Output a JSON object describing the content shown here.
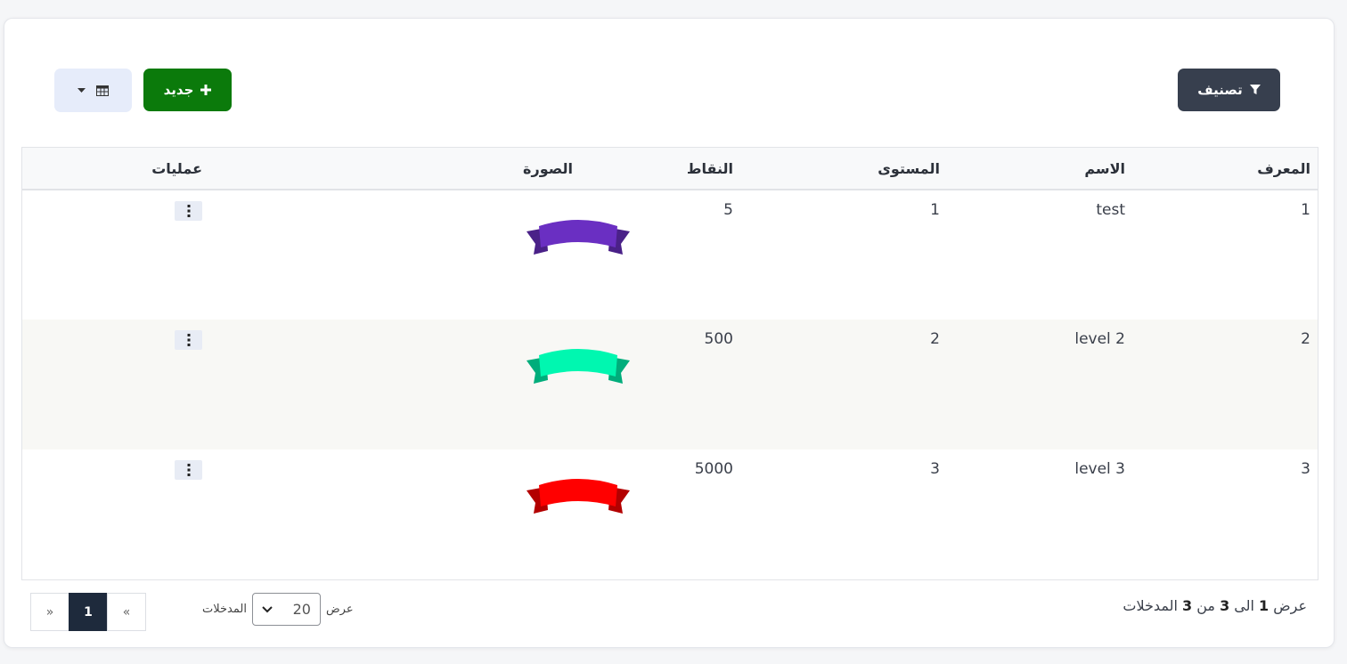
{
  "toolbar": {
    "filter_label": "تصنيف",
    "new_label": "جديد",
    "filter_icon": "filter-icon",
    "new_icon": "plus-icon",
    "columns_icon": "table-icon"
  },
  "table": {
    "headers": {
      "id": "المعرف",
      "name": "الاسم",
      "level": "المستوى",
      "points": "النقاط",
      "image": "الصورة",
      "actions": "عمليات"
    },
    "rows": [
      {
        "id": "1",
        "name": "test",
        "level": "1",
        "points": "5",
        "ribbon_color": "#6a2fc2"
      },
      {
        "id": "2",
        "name": "level 2",
        "level": "2",
        "points": "500",
        "ribbon_color": "#00f7b0"
      },
      {
        "id": "3",
        "name": "level 3",
        "level": "3",
        "points": "5000",
        "ribbon_color": "#ff0000"
      }
    ]
  },
  "footer": {
    "info_prefix": "عرض",
    "info_from": "1",
    "info_to_word": "الى",
    "info_to": "3",
    "info_of_word": "من",
    "info_total": "3",
    "info_suffix": "المدخلات",
    "length_show": "عرض",
    "length_value": "20",
    "length_entries": "المدخلات",
    "pager_prev": "«",
    "pager_current": "1",
    "pager_next": "»"
  },
  "colors": {
    "filter_bg": "#373f4e",
    "new_bg": "#0b7a0b",
    "cols_bg": "#e6ecfa",
    "active_page_bg": "#1e2a3c"
  }
}
